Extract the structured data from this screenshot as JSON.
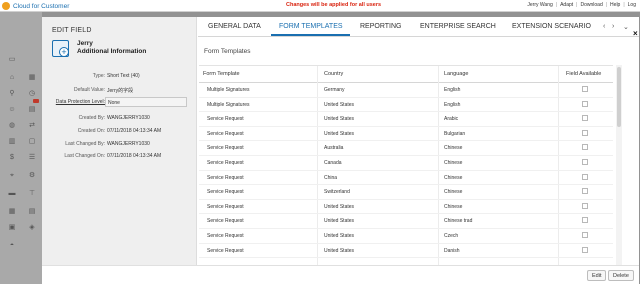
{
  "app": {
    "title": "Cloud for Customer"
  },
  "banner": {
    "text": "Changes will be applied for all users"
  },
  "user_links": [
    "Jerry Wang",
    "Adapt",
    "Download",
    "Help",
    "Log"
  ],
  "dialog": {
    "title": "EDIT FIELD",
    "object_name": "Jerry",
    "object_subtitle": "Additional Information",
    "properties": [
      {
        "key": "Type:",
        "value": "Short Text (40)"
      },
      {
        "key": "Default Value:",
        "value": "Jerry的字段"
      },
      {
        "key": "Data Protection Level:",
        "value": "None"
      },
      {
        "key": "Created By:",
        "value": "WANGJERRY1030"
      },
      {
        "key": "Created On:",
        "value": "07/11/2018 04:13:34 AM"
      },
      {
        "key": "Last Changed By:",
        "value": "WANGJERRY1030"
      },
      {
        "key": "Last Changed On:",
        "value": "07/11/2018 04:13:34 AM"
      }
    ],
    "tabs": [
      "GENERAL DATA",
      "FORM TEMPLATES",
      "REPORTING",
      "ENTERPRISE SEARCH",
      "EXTENSION SCENARIO"
    ],
    "active_tab": "FORM TEMPLATES",
    "section_title": "Form Templates",
    "table": {
      "columns": [
        "Form Template",
        "Country",
        "Language",
        "Field Available"
      ],
      "rows": [
        [
          "Multiple Signatures",
          "Germany",
          "English",
          false
        ],
        [
          "Multiple Signatures",
          "United States",
          "English",
          false
        ],
        [
          "Service Request",
          "United States",
          "Arabic",
          false
        ],
        [
          "Service Request",
          "United States",
          "Bulgarian",
          false
        ],
        [
          "Service Request",
          "Australia",
          "Chinese",
          false
        ],
        [
          "Service Request",
          "Canada",
          "Chinese",
          false
        ],
        [
          "Service Request",
          "China",
          "Chinese",
          false
        ],
        [
          "Service Request",
          "Switzerland",
          "Chinese",
          false
        ],
        [
          "Service Request",
          "United States",
          "Chinese",
          false
        ],
        [
          "Service Request",
          "United States",
          "Chinese trad",
          false
        ],
        [
          "Service Request",
          "United States",
          "Czech",
          false
        ],
        [
          "Service Request",
          "United States",
          "Danish",
          false
        ]
      ]
    },
    "buttons": {
      "edit": "Edit",
      "delete": "Delete"
    }
  },
  "colors": {
    "accent": "#1a6fb0",
    "banner": "#d9230f",
    "brand": "#f0a01e"
  }
}
